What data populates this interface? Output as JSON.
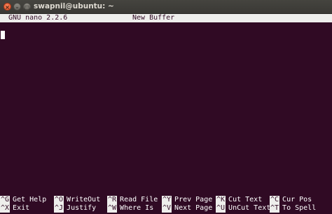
{
  "window": {
    "title": "swapnil@ubuntu: ~",
    "close_glyph": "×",
    "minimize_glyph": "–",
    "maximize_glyph": "□"
  },
  "nano": {
    "version": "GNU nano 2.2.6",
    "filename": "New Buffer"
  },
  "shortcuts": {
    "row1": [
      {
        "key": "^G",
        "label": "Get Help"
      },
      {
        "key": "^O",
        "label": "WriteOut"
      },
      {
        "key": "^R",
        "label": "Read File"
      },
      {
        "key": "^Y",
        "label": "Prev Page"
      },
      {
        "key": "^K",
        "label": "Cut Text"
      },
      {
        "key": "^C",
        "label": "Cur Pos"
      }
    ],
    "row2": [
      {
        "key": "^X",
        "label": "Exit"
      },
      {
        "key": "^J",
        "label": "Justify"
      },
      {
        "key": "^W",
        "label": "Where Is"
      },
      {
        "key": "^V",
        "label": "Next Page"
      },
      {
        "key": "^U",
        "label": "UnCut Text"
      },
      {
        "key": "^T",
        "label": "To Spell"
      }
    ]
  },
  "colors": {
    "background": "#300a24",
    "inverse": "#eeeeec",
    "close_button": "#e4552a"
  }
}
